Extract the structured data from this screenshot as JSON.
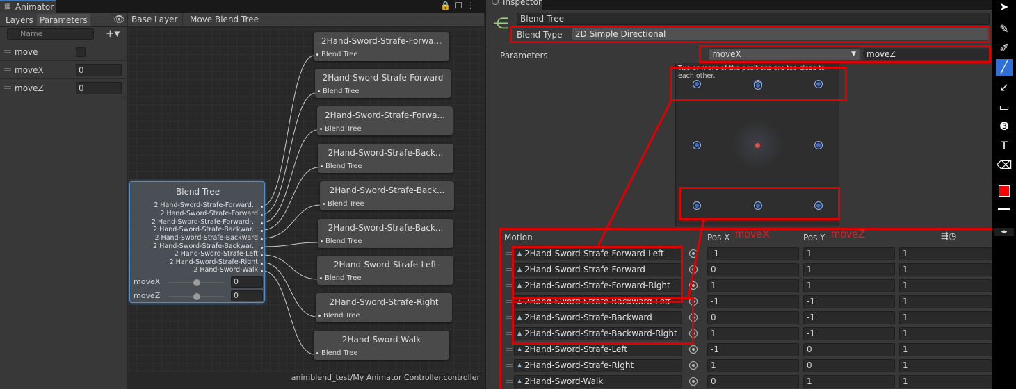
{
  "animator": {
    "title": "Animator",
    "tabs": [
      "Layers",
      "Parameters"
    ],
    "search_placeholder": "Name",
    "parameters": [
      {
        "name": "move",
        "type": "bool",
        "value": ""
      },
      {
        "name": "moveX",
        "type": "float",
        "value": "0"
      },
      {
        "name": "moveZ",
        "type": "float",
        "value": "0"
      }
    ],
    "breadcrumb": [
      "Base Layer",
      "Move Blend Tree"
    ],
    "footer_path": "animblend_test/My Animator Controller.controller",
    "blend_node": {
      "title": "Blend Tree",
      "children": [
        "2 Hand-Sword-Strafe-Forward...",
        "2 Hand-Sword-Strafe-Forward",
        "2 Hand-Sword-Strafe-Forward-...",
        "2 Hand-Sword-Strafe-Backwar...",
        "2 Hand-Sword-Strafe-Backward",
        "2 Hand-Sword-Strafe-Backwar...",
        "2 Hand-Sword-Strafe-Left",
        "2 Hand-Sword-Strafe-Right",
        "2 Hand-Sword-Walk"
      ],
      "params": [
        {
          "name": "moveX",
          "value": "0"
        },
        {
          "name": "moveZ",
          "value": "0"
        }
      ]
    },
    "clip_nodes": [
      {
        "title": "2Hand-Sword-Strafe-Forwa...",
        "sub": "Blend Tree"
      },
      {
        "title": "2Hand-Sword-Strafe-Forward",
        "sub": "Blend Tree"
      },
      {
        "title": "2Hand-Sword-Strafe-Forwa...",
        "sub": "Blend Tree"
      },
      {
        "title": "2Hand-Sword-Strafe-Back...",
        "sub": "Blend Tree"
      },
      {
        "title": "2Hand-Sword-Strafe-Back...",
        "sub": "Blend Tree"
      },
      {
        "title": "2Hand-Sword-Strafe-Back...",
        "sub": "Blend Tree"
      },
      {
        "title": "2Hand-Sword-Strafe-Left",
        "sub": "Blend Tree"
      },
      {
        "title": "2Hand-Sword-Strafe-Right",
        "sub": "Blend Tree"
      },
      {
        "title": "2Hand-Sword-Walk",
        "sub": "Blend Tree"
      }
    ]
  },
  "inspector": {
    "title": "Inspector",
    "name_value": "Blend Tree",
    "blend_type_label": "Blend Type",
    "blend_type_value": "2D Simple Directional",
    "parameters_label": "Parameters",
    "param_x": "moveX",
    "param_z": "moveZ",
    "warning": "Two or more of the positions are too close to each other.",
    "motion_header": {
      "motion": "Motion",
      "pos_x": "Pos X",
      "pos_y": "Pos Y",
      "time_icon": "clock-icon"
    },
    "annotations": {
      "x": "moveX",
      "z": "moveZ"
    },
    "motions": [
      {
        "clip": "2Hand-Sword-Strafe-Forward-Left",
        "x": "-1",
        "y": "1",
        "t": "1"
      },
      {
        "clip": "2Hand-Sword-Strafe-Forward",
        "x": "0",
        "y": "1",
        "t": "1"
      },
      {
        "clip": "2Hand-Sword-Strafe-Forward-Right",
        "x": "1",
        "y": "1",
        "t": "1"
      },
      {
        "clip": "2Hand-Sword-Strafe-Backward-Left",
        "x": "-1",
        "y": "-1",
        "t": "1"
      },
      {
        "clip": "2Hand-Sword-Strafe-Backward",
        "x": "0",
        "y": "-1",
        "t": "1"
      },
      {
        "clip": "2Hand-Sword-Strafe-Backward-Right",
        "x": "1",
        "y": "-1",
        "t": "1"
      },
      {
        "clip": "2Hand-Sword-Strafe-Left",
        "x": "-1",
        "y": "0",
        "t": "1"
      },
      {
        "clip": "2Hand-Sword-Strafe-Right",
        "x": "1",
        "y": "0",
        "t": "1"
      },
      {
        "clip": "2Hand-Sword-Walk",
        "x": "0",
        "y": "1",
        "t": "1"
      }
    ]
  },
  "toolbar": {
    "tools": [
      "cursor-icon",
      "pen-icon",
      "marker-icon",
      "line-icon",
      "arrow-icon",
      "rectangle-icon",
      "step-counter-icon",
      "text-icon",
      "eraser-icon"
    ],
    "active_tool": "line-icon",
    "color": "#ff0000",
    "colors": {
      "annotation": "#e00000",
      "selection": "#3a79bb"
    }
  }
}
